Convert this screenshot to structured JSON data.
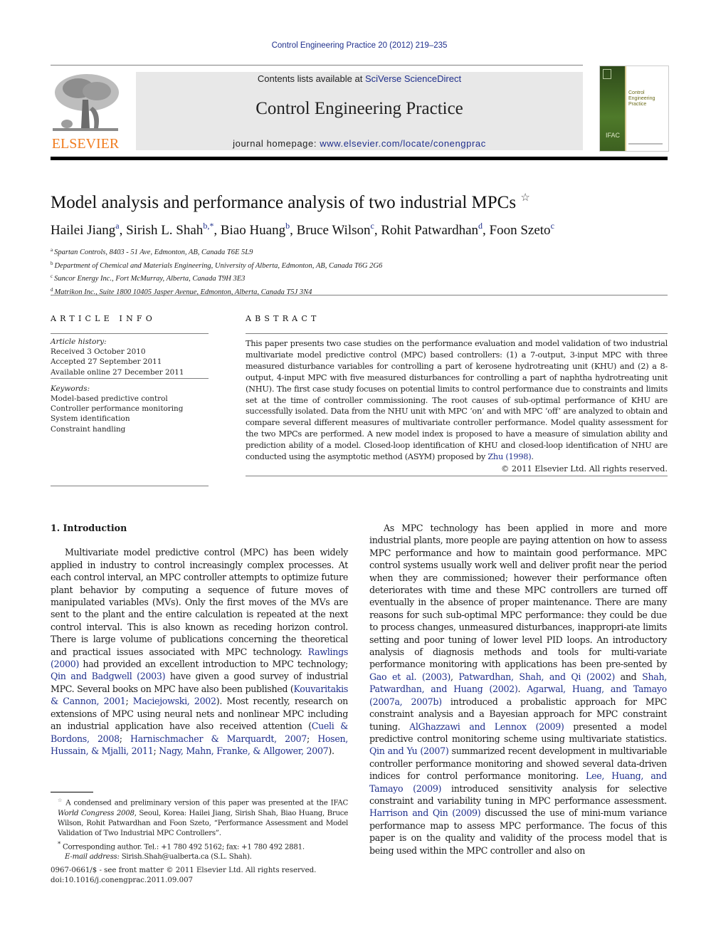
{
  "running_head": "Control Engineering Practice 20 (2012) 219–235",
  "header": {
    "publisher_logo_text": "ELSEVIER",
    "contents_prefix": "Contents lists available at ",
    "contents_link": "SciVerse ScienceDirect",
    "journal_title": "Control Engineering Practice",
    "homepage_prefix": "journal homepage: ",
    "homepage_link": "www.elsevier.com/locate/conengprac",
    "cover_title_line1": "Control",
    "cover_title_line2": "Engineering",
    "cover_title_line3": "Practice",
    "cover_badge": "IFAC",
    "colors": {
      "elsevier_orange": "#f07c1e",
      "link_blue": "#1f2f8c",
      "banner_gray": "#e8e8e8",
      "cover_green": "#4f7a2a"
    }
  },
  "article": {
    "title": "Model analysis and performance analysis of two industrial MPCs",
    "title_mark": "☆",
    "authors": [
      {
        "name": "Hailei Jiang",
        "sup": "a"
      },
      {
        "name": "Sirish L. Shah",
        "sup": "b,*"
      },
      {
        "name": "Biao Huang",
        "sup": "b"
      },
      {
        "name": "Bruce Wilson",
        "sup": "c"
      },
      {
        "name": "Rohit Patwardhan",
        "sup": "d"
      },
      {
        "name": "Foon Szeto",
        "sup": "c"
      }
    ],
    "affiliations": [
      {
        "mark": "a",
        "text": "Spartan Controls, 8403 - 51 Ave, Edmonton, AB, Canada T6E 5L9"
      },
      {
        "mark": "b",
        "text": "Department of Chemical and Materials Engineering, University of Alberta, Edmonton, AB, Canada T6G 2G6"
      },
      {
        "mark": "c",
        "text": "Suncor Energy Inc., Fort McMurray, Alberta, Canada T9H 3E3"
      },
      {
        "mark": "d",
        "text": "Matrikon Inc., Suite 1800 10405 Jasper Avenue, Edmonton, Alberta, Canada T5J 3N4"
      }
    ]
  },
  "article_info": {
    "heading": "ARTICLE INFO",
    "history_label": "Article history:",
    "history": [
      "Received 3 October 2010",
      "Accepted 27 September 2011",
      "Available online 27 December 2011"
    ],
    "keywords_label": "Keywords:",
    "keywords": [
      "Model-based predictive control",
      "Controller performance monitoring",
      "System identification",
      "Constraint handling"
    ]
  },
  "abstract": {
    "heading": "ABSTRACT",
    "text": "This paper presents two case studies on the performance evaluation and model validation of two industrial multivariate model predictive control (MPC) based controllers: (1) a 7-output, 3-input MPC with three measured disturbance variables for controlling a part of kerosene hydrotreating unit (KHU) and (2) a 8-output, 4-input MPC with five measured disturbances for controlling a part of naphtha hydrotreating unit (NHU). The first case study focuses on potential limits to control performance due to constraints and limits set at the time of controller commissioning. The root causes of sub-optimal performance of KHU are successfully isolated. Data from the NHU unit with MPC ‘on’ and with MPC ‘off’ are analyzed to obtain and compare several different measures of multivariate controller performance. Model quality assessment for the two MPCs are performed. A new model index is proposed to have a measure of simulation ability and prediction ability of a model. Closed-loop identification of KHU and closed-loop identification of NHU are conducted using the asymptotic method (ASYM) proposed by ",
    "cite": "Zhu (1998)",
    "end": ".",
    "copyright": "© 2011 Elsevier Ltd. All rights reserved."
  },
  "body": {
    "section_heading": "1.  Introduction",
    "left_p1": "Multivariate model predictive control (MPC) has been widely applied in industry to control increasingly complex processes. At each control interval, an MPC controller attempts to optimize future plant behavior by computing a sequence of future moves of manipulated variables (MVs). Only the first moves of the MVs are sent to the plant and the entire calculation is repeated at the next control interval. This is also known as receding horizon control. There is large volume of publications concerning the theoretical and practical issues associated with MPC technology. ",
    "left_segments": [
      {
        "t": "Rawlings (2000)",
        "link": true
      },
      {
        "t": " had provided an excellent introduction to MPC technology; ",
        "link": false
      },
      {
        "t": "Qin and Badgwell (2003)",
        "link": true
      },
      {
        "t": " have given a good survey of industrial MPC. Several books on MPC have also been published (",
        "link": false
      },
      {
        "t": "Kouvaritakis & Cannon, 2001",
        "link": true
      },
      {
        "t": "; ",
        "link": false
      },
      {
        "t": "Maciejowski, 2002",
        "link": true
      },
      {
        "t": "). Most recently, research on extensions of MPC using neural nets and nonlinear MPC including an industrial application have also received attention (",
        "link": false
      },
      {
        "t": "Cueli & Bordons, 2008",
        "link": true
      },
      {
        "t": "; ",
        "link": false
      },
      {
        "t": "Harnischmacher & Marquardt, 2007",
        "link": true
      },
      {
        "t": "; ",
        "link": false
      },
      {
        "t": "Hosen, Hussain, & Mjalli, 2011",
        "link": true
      },
      {
        "t": "; ",
        "link": false
      },
      {
        "t": "Nagy, Mahn, Franke, & Allgower, 2007",
        "link": true
      },
      {
        "t": ").",
        "link": false
      }
    ],
    "right_segments": [
      {
        "t": "As MPC technology has been applied in more and more industrial plants, more people are paying attention on how to assess MPC performance and how to maintain good performance. MPC control systems usually work well and deliver profit near the period when they are commissioned; however their performance often deteriorates with time and these MPC controllers are turned off eventually in the absence of proper maintenance. There are many reasons for such sub-optimal MPC performance: they could be due to process changes, unmeasured disturbances, inappropri-ate limits setting and poor tuning of lower level PID loops. An introductory analysis of diagnosis methods and tools for multi-variate performance monitoring with applications has been pre-sented by ",
        "link": false
      },
      {
        "t": "Gao et al. (2003)",
        "link": true
      },
      {
        "t": ", ",
        "link": false
      },
      {
        "t": "Patwardhan, Shah, and Qi (2002)",
        "link": true
      },
      {
        "t": " and ",
        "link": false
      },
      {
        "t": "Shah, Patwardhan, and Huang (2002)",
        "link": true
      },
      {
        "t": ". ",
        "link": false
      },
      {
        "t": "Agarwal, Huang, and Tamayo (2007a, 2007b)",
        "link": true
      },
      {
        "t": " introduced a probalistic approach for MPC constraint analysis and a Bayesian approach for MPC constraint tuning. ",
        "link": false
      },
      {
        "t": "AlGhazzawi and Lennox (2009)",
        "link": true
      },
      {
        "t": " presented a model predictive control monitoring scheme using multivariate statistics. ",
        "link": false
      },
      {
        "t": "Qin and Yu (2007)",
        "link": true
      },
      {
        "t": " summarized recent development in multivariable controller performance monitoring and showed several data-driven indices for control performance monitoring. ",
        "link": false
      },
      {
        "t": "Lee, Huang, and Tamayo (2009)",
        "link": true
      },
      {
        "t": " introduced sensitivity analysis for selective constraint and variability tuning in MPC performance assessment. ",
        "link": false
      },
      {
        "t": "Harrison and Qin (2009)",
        "link": true
      },
      {
        "t": " discussed the use of mini-mum variance performance map to assess MPC performance. The focus of this paper is on the quality and validity of the process model that is being used within the MPC controller and also on",
        "link": false
      }
    ]
  },
  "footnotes": {
    "star_mark": "☆",
    "star_text_1": " A condensed and preliminary version of this paper was presented at the IFAC ",
    "star_italic": "World Congress 2008",
    "star_text_2": ", Seoul, Korea: Hailei Jiang, Sirish Shah, Biao Huang, Bruce Wilson, Rohit Patwardhan and Foon Szeto, “Performance Assessment and Model Validation of Two Industrial MPC Controllers”.",
    "corr_mark": "*",
    "corr_text": " Corresponding author. Tel.: +1 780 492 5162; fax: +1 780 492 2881.",
    "email_label": "E-mail address:",
    "email_value": " Sirish.Shah@ualberta.ca (S.L. Shah)."
  },
  "bottom": {
    "issn_line": "0967-0661/$ - see front matter © 2011 Elsevier Ltd. All rights reserved.",
    "doi_line": "doi:10.1016/j.conengprac.2011.09.007"
  }
}
